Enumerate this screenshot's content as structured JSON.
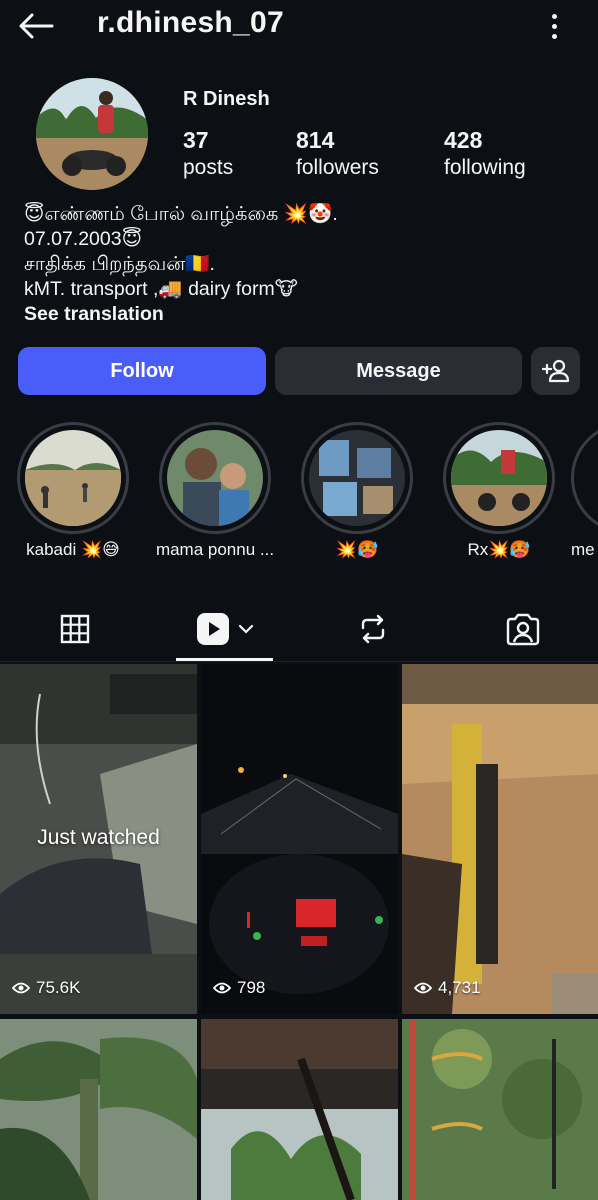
{
  "header": {
    "username": "r.dhinesh_07",
    "back_icon": "arrow-left-icon",
    "more_icon": "more-vertical-icon"
  },
  "profile": {
    "display_name": "R Dinesh",
    "stats": [
      {
        "value": "37",
        "label": "posts"
      },
      {
        "value": "814",
        "label": "followers"
      },
      {
        "value": "428",
        "label": "following"
      }
    ],
    "bio": [
      "😇எண்ணம் போல் வாழ்க்கை 💥🤡.",
      "07.07.2003😇",
      "சாதிக்க பிறந்தவன்🇷🇴.",
      "kMT. transport ,🚚 dairy form🐮"
    ],
    "see_translation": "See translation"
  },
  "actions": {
    "follow": "Follow",
    "message": "Message",
    "add_user_icon": "add-user-icon"
  },
  "highlights": [
    {
      "label": "kabadi 💥😅"
    },
    {
      "label": "mama ponnu ..."
    },
    {
      "label": "💥🥵"
    },
    {
      "label": "Rx💥🥵"
    },
    {
      "label": "me"
    }
  ],
  "tabs": [
    {
      "icon": "grid-icon"
    },
    {
      "icon": "reels-icon"
    },
    {
      "icon": "repost-icon"
    },
    {
      "icon": "tagged-icon"
    }
  ],
  "grid": [
    {
      "overlay": "Just watched",
      "views": "75.6K"
    },
    {
      "views": "798"
    },
    {
      "views": "4,731"
    },
    {
      "views": ""
    },
    {
      "views": ""
    },
    {
      "views": ""
    }
  ],
  "colors": {
    "accent": "#4a5df9",
    "background": "#0c0f14",
    "button": "#2a2d34"
  }
}
